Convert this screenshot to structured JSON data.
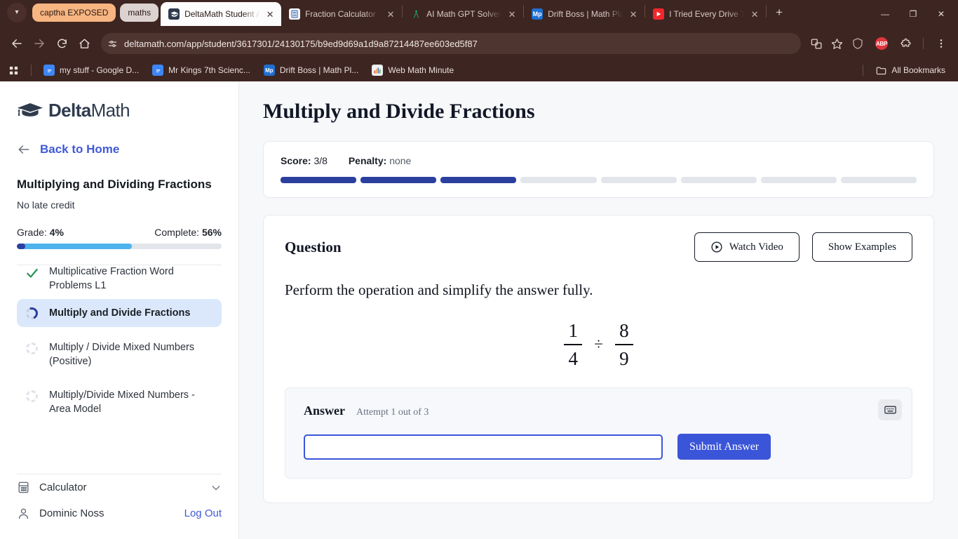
{
  "browser": {
    "tab_groups": [
      {
        "label": "captha EXPOSED",
        "color": "#f7b581"
      },
      {
        "label": "maths",
        "color": "#dcd3d1"
      }
    ],
    "tabs": [
      {
        "title": "DeltaMath Student App",
        "icon": "graduation-cap-favicon",
        "active": true
      },
      {
        "title": "Fraction Calculator",
        "icon": "calculator-favicon",
        "active": false
      },
      {
        "title": "AI Math GPT Solver Po",
        "icon": "compass-favicon",
        "active": false
      },
      {
        "title": "Drift Boss | Math Playg",
        "icon": "mathplayground-favicon",
        "active": false
      },
      {
        "title": "I Tried Every Drive Thru",
        "icon": "youtube-favicon",
        "active": false
      }
    ],
    "new_tab_label": "+",
    "window_controls": {
      "minimize": "—",
      "maximize": "❐",
      "close": "✕"
    },
    "url": "deltamath.com/app/student/3617301/24130175/b9ed9d69a1d9a87214487ee603ed5f87",
    "bookmarks": [
      {
        "label": "my stuff - Google D...",
        "icon": "google-docs-favicon"
      },
      {
        "label": "Mr Kings 7th Scienc...",
        "icon": "google-docs-favicon"
      },
      {
        "label": "Drift Boss | Math Pl...",
        "icon": "mathplayground-favicon"
      },
      {
        "label": "Web Math Minute",
        "icon": "webmathminute-favicon"
      }
    ],
    "all_bookmarks_label": "All Bookmarks",
    "extension_badge": "ABP",
    "chrome_color": "#3d2521"
  },
  "sidebar": {
    "logo": {
      "bold": "Delta",
      "light": "Math"
    },
    "back_to_home": "Back to Home",
    "assignment_title": "Multiplying and Dividing Fractions",
    "late_credit": "No late credit",
    "grade_label": "Grade:",
    "grade_value": "4%",
    "complete_label": "Complete:",
    "complete_value": "56%",
    "grade_percent": 4,
    "complete_percent": 56,
    "topics": [
      {
        "label": "Multiplicative Fraction Word Problems L1",
        "state": "complete"
      },
      {
        "label": "Multiply and Divide Fractions",
        "state": "in-progress"
      },
      {
        "label": "Multiply / Divide Mixed Numbers (Positive)",
        "state": "not-started"
      },
      {
        "label": "Multiply/Divide Mixed Numbers - Area Model",
        "state": "not-started"
      }
    ],
    "calculator_label": "Calculator",
    "user_name": "Dominic Noss",
    "logout_label": "Log Out"
  },
  "main": {
    "page_title": "Multiply and Divide Fractions",
    "score": {
      "score_label": "Score:",
      "score_value": "3/8",
      "penalty_label": "Penalty:",
      "penalty_value": "none",
      "segments_total": 8,
      "segments_filled": 3,
      "fill_color": "#2b3f9e"
    },
    "question": {
      "header": "Question",
      "watch_video_label": "Watch Video",
      "show_examples_label": "Show Examples",
      "prompt": "Perform the operation and simplify the answer fully.",
      "expression": {
        "left": {
          "numerator": "1",
          "denominator": "4"
        },
        "operator": "÷",
        "right": {
          "numerator": "8",
          "denominator": "9"
        }
      }
    },
    "answer": {
      "label": "Answer",
      "attempt_text": "Attempt 1 out of 3",
      "input_value": "",
      "input_placeholder": "",
      "submit_label": "Submit Answer",
      "keyboard_icon": "keyboard-icon",
      "accent_color": "#3b55d9"
    }
  }
}
